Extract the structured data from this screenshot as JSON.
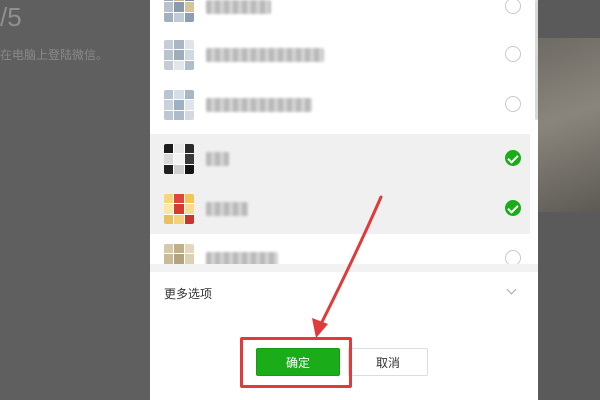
{
  "background": {
    "step_text": "/5",
    "caption": "在电脑上登陆微信。"
  },
  "contacts": [
    {
      "avatar_colors": [
        "#9aa7b8",
        "#c9b48a",
        "#7d8ea3",
        "#b8c2ce",
        "#8a9aaf",
        "#d6c49c",
        "#a4b0bf",
        "#c2cad6",
        "#8f9db0"
      ],
      "avatar_style": "grid",
      "name_width": 0.17,
      "selected": false
    },
    {
      "avatar_colors": [
        "#c5ced8",
        "#aab6c4",
        "#dfe4ea",
        "#b9c3cf",
        "#9eacbb",
        "#d0d8e1",
        "#c4ccd6",
        "#e2e6eb",
        "#b2bdca"
      ],
      "avatar_style": "grid",
      "name_width": 0.31,
      "selected": false
    },
    {
      "avatar_colors": [
        "#b8c4d2",
        "#d5dde6",
        "#a9b6c5",
        "#c9d2dc",
        "#9fb0c2",
        "#e0e5eb",
        "#bcc7d3",
        "#aebbc9",
        "#d2d9e2"
      ],
      "avatar_style": "grid",
      "name_width": 0.28,
      "selected": false
    },
    {
      "avatar_colors": [
        "#1c1c1c",
        "#e8e8e8",
        "#2b2b2b",
        "#d9d9d9",
        "#f4f4f4",
        "#3a3a3a",
        "#202020",
        "#cfcfcf",
        "#141414"
      ],
      "avatar_style": "photo-dark",
      "name_width": 0.06,
      "selected": true
    },
    {
      "avatar_colors": [
        "#f5d77a",
        "#e0463c",
        "#f2c45a",
        "#fbe7a6",
        "#d93a30",
        "#f7dc8c",
        "#eac05c",
        "#f4d27a",
        "#c9342b"
      ],
      "avatar_style": "photo-warm",
      "name_width": 0.11,
      "selected": true
    },
    {
      "avatar_colors": [
        "#d6c9a8",
        "#bfb08a",
        "#e3d8bd",
        "#c9bb98",
        "#b3a37f",
        "#ddd1b4",
        "#cdbf9f",
        "#e8dfc8",
        "#c2b392"
      ],
      "avatar_style": "grid",
      "name_width": 0.19,
      "selected": false
    }
  ],
  "more_options": {
    "label": "更多选项",
    "icon": "chevron-down-icon"
  },
  "buttons": {
    "confirm_label": "确定",
    "cancel_label": "取消"
  },
  "colors": {
    "accent_green": "#1aad19",
    "annotation_red": "#e03a3a"
  }
}
